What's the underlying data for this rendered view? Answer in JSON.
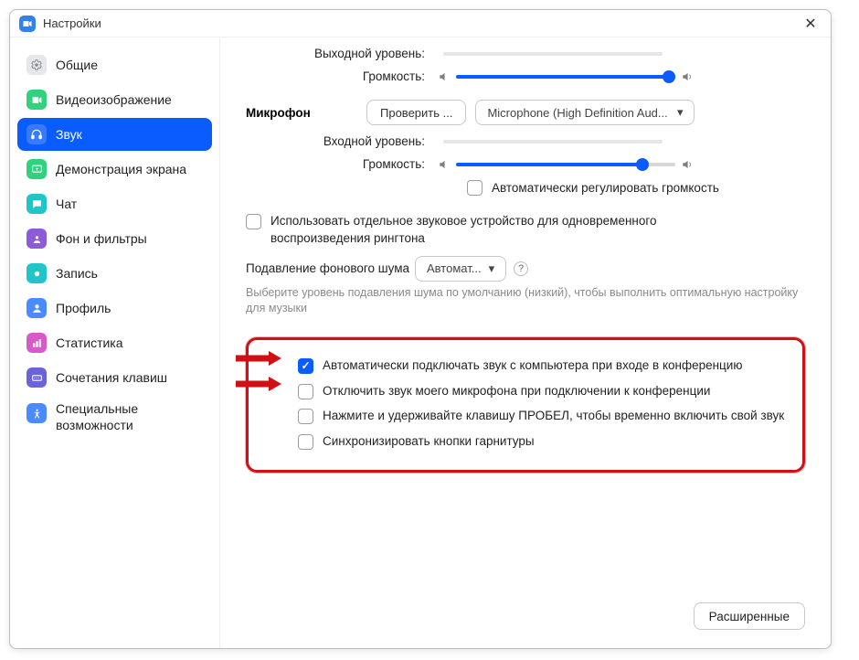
{
  "window": {
    "title": "Настройки"
  },
  "sidebar": {
    "items": [
      {
        "label": "Общие"
      },
      {
        "label": "Видеоизображение"
      },
      {
        "label": "Звук"
      },
      {
        "label": "Демонстрация экрана"
      },
      {
        "label": "Чат"
      },
      {
        "label": "Фон и фильтры"
      },
      {
        "label": "Запись"
      },
      {
        "label": "Профиль"
      },
      {
        "label": "Статистика"
      },
      {
        "label": "Сочетания клавиш"
      },
      {
        "label": "Специальные возможности"
      }
    ],
    "active_index": 2
  },
  "audio": {
    "output_level_label": "Выходной уровень:",
    "speaker_volume_label": "Громкость:",
    "speaker_volume_percent": 100,
    "microphone_heading": "Микрофон",
    "mic_test_button": "Проверить ...",
    "mic_device_selected": "Microphone (High Definition Aud...",
    "input_level_label": "Входной уровень:",
    "mic_volume_label": "Громкость:",
    "mic_volume_percent": 85,
    "auto_adjust_volume": "Автоматически регулировать громкость",
    "auto_adjust_volume_checked": false,
    "separate_ringtone": "Использовать отдельное звуковое устройство для одновременного воспроизведения рингтона",
    "separate_ringtone_checked": false,
    "noise_label": "Подавление фонового шума",
    "noise_value": "Автомат...",
    "noise_hint": "Выберите уровень подавления шума по умолчанию (низкий), чтобы выполнить оптимальную настройку для музыки",
    "checkboxes": [
      {
        "label": "Автоматически подключать звук с компьютера при входе в конференцию",
        "checked": true
      },
      {
        "label": "Отключить звук моего микрофона при подключении к конференции",
        "checked": false
      },
      {
        "label": "Нажмите и удерживайте клавишу ПРОБЕЛ, чтобы временно включить свой звук",
        "checked": false
      },
      {
        "label": "Синхронизировать кнопки гарнитуры",
        "checked": false
      }
    ],
    "advanced_button": "Расширенные"
  },
  "colors": {
    "accent": "#0b5cff",
    "highlight": "#d01015"
  }
}
